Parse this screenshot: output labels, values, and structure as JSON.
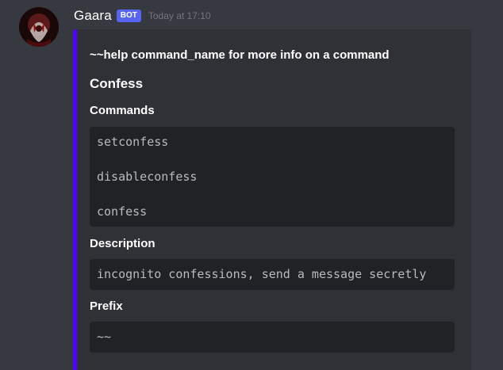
{
  "message": {
    "author": "Gaara",
    "bot_tag": "BOT",
    "timestamp": "Today at 17:10"
  },
  "embed": {
    "accent_color": "#5200ff",
    "description": "~~help command_name for more info on a command",
    "title": "Confess",
    "fields": [
      {
        "name": "Commands",
        "lines": [
          "setconfess",
          "disableconfess",
          "confess"
        ]
      },
      {
        "name": "Description",
        "lines": [
          "incognito confessions, send a message secretly"
        ]
      },
      {
        "name": "Prefix",
        "lines": [
          "~~"
        ]
      }
    ]
  },
  "colors": {
    "background": "#36393f",
    "embed_bg": "#2f3136",
    "code_bg": "#202225",
    "bot_tag": "#5865f2",
    "timestamp": "#72767d"
  },
  "icons": {
    "avatar": "avatar-image"
  }
}
